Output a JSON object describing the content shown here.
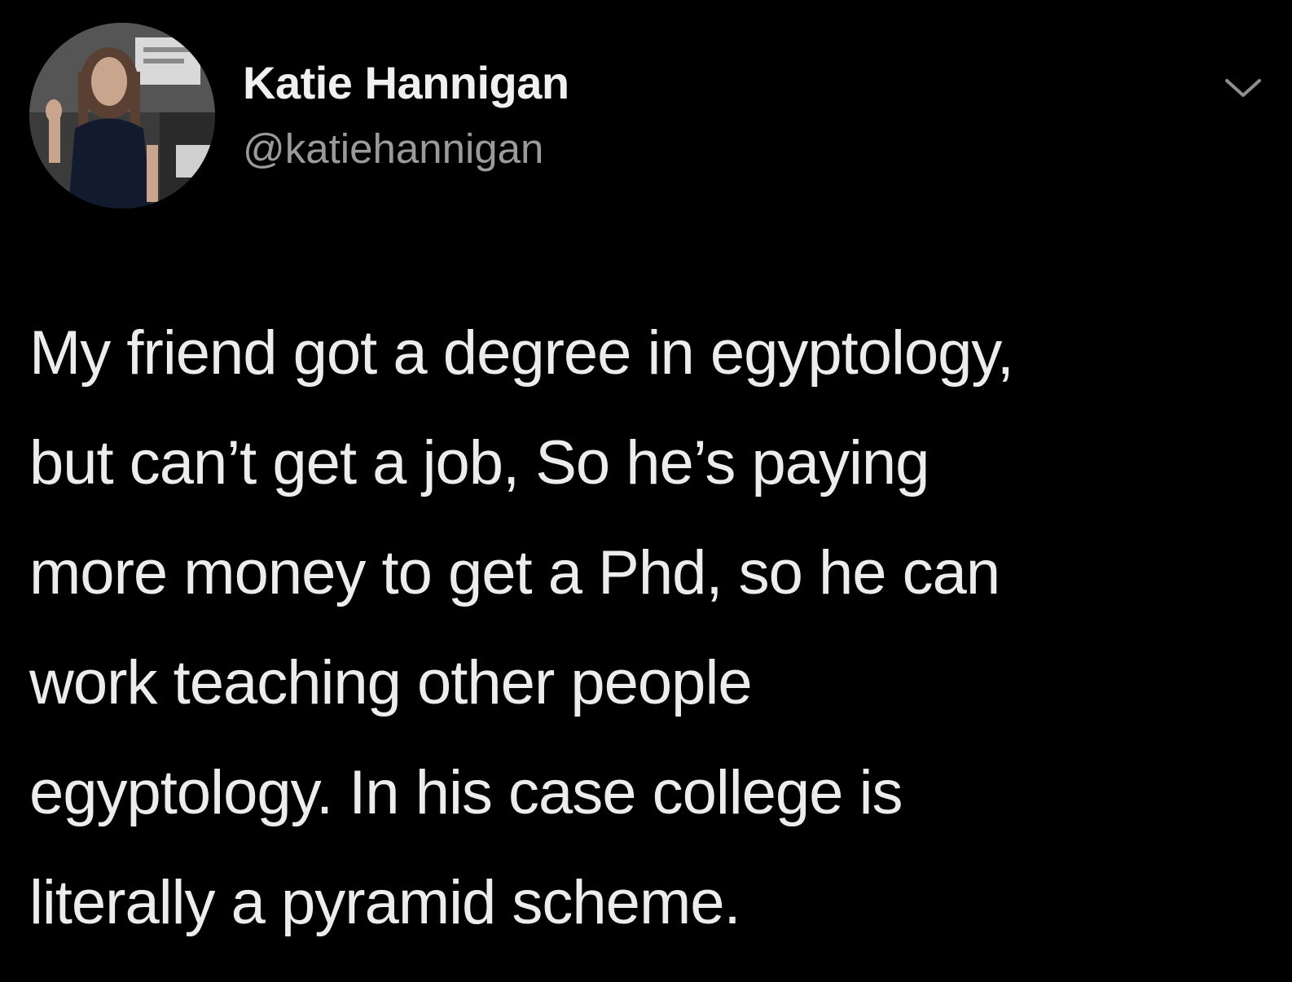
{
  "tweet": {
    "author": {
      "display_name": "Katie Hannigan",
      "handle": "@katiehannigan",
      "avatar_icon": "profile-photo"
    },
    "more_icon": "chevron-down-icon",
    "text_lines": [
      "My friend got a degree in egyptology,",
      "but can’t get a job, So he’s paying",
      "more money to get a Phd, so he can",
      "work teaching other people",
      "egyptology.  In his case college is",
      "literally a pyramid scheme."
    ]
  },
  "colors": {
    "background": "#000000",
    "primary_text": "#ececec",
    "secondary_text": "#9a9a9a"
  }
}
